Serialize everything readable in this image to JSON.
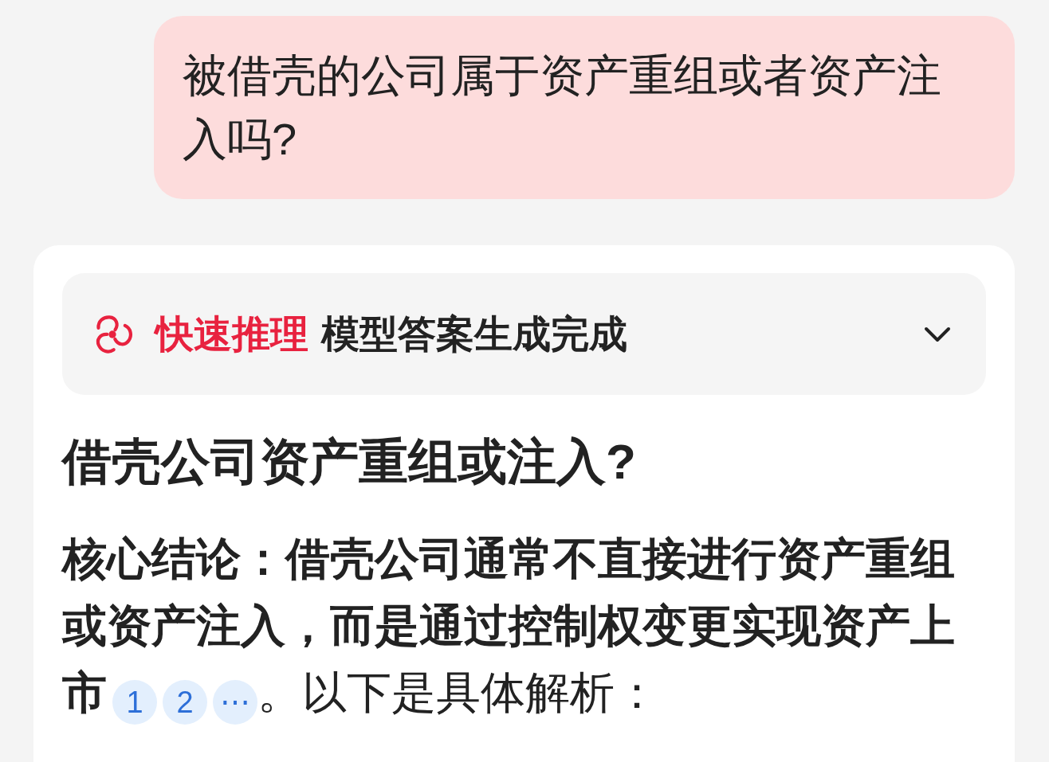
{
  "user_message": {
    "text": "被借壳的公司属于资产重组或者资产注入吗?"
  },
  "answer": {
    "status": {
      "mode": "快速推理",
      "text": "模型答案生成完成",
      "expanded": false
    },
    "heading": "借壳公司资产重组或注入?",
    "paragraph": {
      "lead": "核心结论：借壳公司通常不直接进行资产重组或资产注入，而是通过控制权变更实现资产上市",
      "citations": [
        {
          "label": "1"
        },
        {
          "label": "2"
        },
        {
          "label": "⋯"
        }
      ],
      "tail": "。以下是具体解析："
    }
  }
}
